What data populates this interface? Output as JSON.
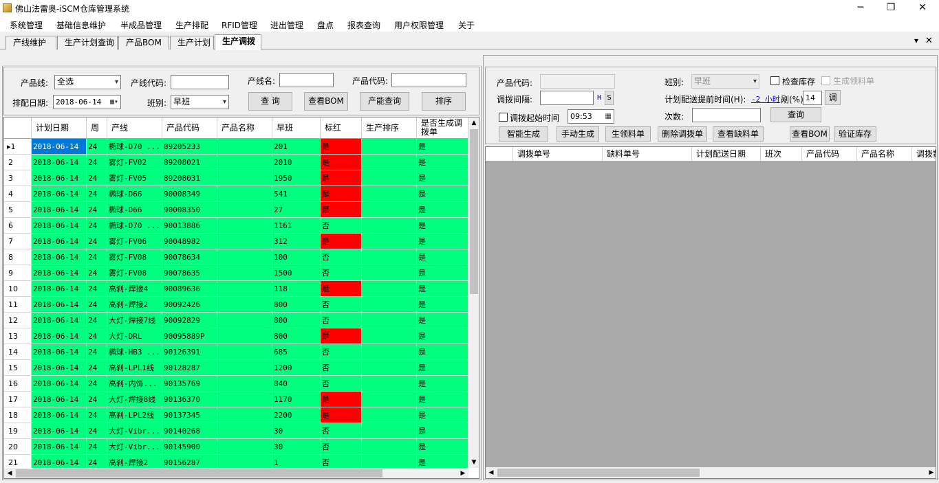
{
  "window": {
    "title": "佛山法雷奥-iSCM仓库管理系统",
    "minimize": "─",
    "maximize": "❐",
    "close": "✕"
  },
  "menu": [
    "系统管理",
    "基础信息维护",
    "半成品管理",
    "生产排配",
    "RFID管理",
    "进出管理",
    "盘点",
    "报表查询",
    "用户权限管理",
    "关于"
  ],
  "tabs": [
    "产线维护",
    "生产计划查询",
    "产品BOM",
    "生产计划",
    "生产调拨"
  ],
  "tab_controls": {
    "dropdown": "▾",
    "close": "✕"
  },
  "left_form": {
    "line_label": "产品线:",
    "line_value": "全选",
    "line_code_label": "产线代码:",
    "line_code_value": "",
    "line_name_label": "产线名:",
    "line_name_value": "",
    "product_code_label": "产品代码:",
    "product_code_value": "",
    "date_label": "排配日期:",
    "date_value": "2018-06-14",
    "shift_label": "班别:",
    "shift_value": "早班",
    "query_btn": "查 询",
    "bom_btn": "查看BOM",
    "capacity_btn": "产能查询",
    "sort_btn": "排序"
  },
  "left_grid": {
    "columns": [
      "计划日期",
      "周",
      "产线",
      "产品代码",
      "产品名称",
      "早班",
      "标红",
      "生产排序",
      "是否生成调拨单"
    ],
    "rows": [
      {
        "n": "1",
        "date": "2018-06-14",
        "week": "24",
        "line": "椭球-D70 ...",
        "code": "89205233",
        "name": "",
        "qty": "201",
        "red": "是",
        "sort": "",
        "gen": "是"
      },
      {
        "n": "2",
        "date": "2018-06-14",
        "week": "24",
        "line": "雾灯-FV02",
        "code": "89208021",
        "name": "",
        "qty": "2010",
        "red": "是",
        "sort": "",
        "gen": "是"
      },
      {
        "n": "3",
        "date": "2018-06-14",
        "week": "24",
        "line": "雾灯-FV05",
        "code": "89208031",
        "name": "",
        "qty": "1950",
        "red": "是",
        "sort": "",
        "gen": "是"
      },
      {
        "n": "4",
        "date": "2018-06-14",
        "week": "24",
        "line": "椭球-D66",
        "code": "90008349",
        "name": "",
        "qty": "541",
        "red": "是",
        "sort": "",
        "gen": "是"
      },
      {
        "n": "5",
        "date": "2018-06-14",
        "week": "24",
        "line": "椭球-D66",
        "code": "90008350",
        "name": "",
        "qty": "27",
        "red": "是",
        "sort": "",
        "gen": "是"
      },
      {
        "n": "6",
        "date": "2018-06-14",
        "week": "24",
        "line": "椭球-D70 ...",
        "code": "90013886",
        "name": "",
        "qty": "1161",
        "red": "否",
        "sort": "",
        "gen": "是"
      },
      {
        "n": "7",
        "date": "2018-06-14",
        "week": "24",
        "line": "雾灯-FV06",
        "code": "90048982",
        "name": "",
        "qty": "312",
        "red": "是",
        "sort": "",
        "gen": "是"
      },
      {
        "n": "8",
        "date": "2018-06-14",
        "week": "24",
        "line": "雾灯-FV08",
        "code": "90078634",
        "name": "",
        "qty": "100",
        "red": "否",
        "sort": "",
        "gen": "是"
      },
      {
        "n": "9",
        "date": "2018-06-14",
        "week": "24",
        "line": "雾灯-FV08",
        "code": "90078635",
        "name": "",
        "qty": "1500",
        "red": "否",
        "sort": "",
        "gen": "是"
      },
      {
        "n": "10",
        "date": "2018-06-14",
        "week": "24",
        "line": "高刹-焊接4",
        "code": "90089636",
        "name": "",
        "qty": "118",
        "red": "是",
        "sort": "",
        "gen": "是"
      },
      {
        "n": "11",
        "date": "2018-06-14",
        "week": "24",
        "line": "高刹-焊接2",
        "code": "90092426",
        "name": "",
        "qty": "800",
        "red": "否",
        "sort": "",
        "gen": "是"
      },
      {
        "n": "12",
        "date": "2018-06-14",
        "week": "24",
        "line": "大灯-焊接7线",
        "code": "90092829",
        "name": "",
        "qty": "800",
        "red": "否",
        "sort": "",
        "gen": "是"
      },
      {
        "n": "13",
        "date": "2018-06-14",
        "week": "24",
        "line": "大灯-DRL",
        "code": "90095889P",
        "name": "",
        "qty": "800",
        "red": "是",
        "sort": "",
        "gen": "是"
      },
      {
        "n": "14",
        "date": "2018-06-14",
        "week": "24",
        "line": "椭球-HB3 ...",
        "code": "90126391",
        "name": "",
        "qty": "685",
        "red": "否",
        "sort": "",
        "gen": "是"
      },
      {
        "n": "15",
        "date": "2018-06-14",
        "week": "24",
        "line": "高刹-LPL1线",
        "code": "90128287",
        "name": "",
        "qty": "1200",
        "red": "否",
        "sort": "",
        "gen": "是"
      },
      {
        "n": "16",
        "date": "2018-06-14",
        "week": "24",
        "line": "高刹-内饰...",
        "code": "90135769",
        "name": "",
        "qty": "840",
        "red": "否",
        "sort": "",
        "gen": "是"
      },
      {
        "n": "17",
        "date": "2018-06-14",
        "week": "24",
        "line": "大灯-焊接8线",
        "code": "90136370",
        "name": "",
        "qty": "1170",
        "red": "是",
        "sort": "",
        "gen": "是"
      },
      {
        "n": "18",
        "date": "2018-06-14",
        "week": "24",
        "line": "高刹-LPL2线",
        "code": "90137345",
        "name": "",
        "qty": "2200",
        "red": "是",
        "sort": "",
        "gen": "是"
      },
      {
        "n": "19",
        "date": "2018-06-14",
        "week": "24",
        "line": "大灯-Vibr...",
        "code": "90140268",
        "name": "",
        "qty": "30",
        "red": "否",
        "sort": "",
        "gen": "是"
      },
      {
        "n": "20",
        "date": "2018-06-14",
        "week": "24",
        "line": "大灯-Vibr...",
        "code": "90145900",
        "name": "",
        "qty": "30",
        "red": "否",
        "sort": "",
        "gen": "是"
      },
      {
        "n": "21",
        "date": "2018-06-14",
        "week": "24",
        "line": "高刹-焊接2",
        "code": "90156287",
        "name": "",
        "qty": "1",
        "red": "否",
        "sort": "",
        "gen": "是"
      }
    ]
  },
  "right_form": {
    "product_code_label": "产品代码:",
    "product_code_value": "",
    "shift_label": "班别:",
    "shift_value": "早班",
    "check_stock_label": "检查库存",
    "gen_pick_label": "生成领料单",
    "interval_label": "调拨间隔:",
    "interval_value": "",
    "unit_h": "H",
    "unit_s": "S",
    "lead_time_label": "计划配送提前时间(H):",
    "lead_time_link": "-2 小时",
    "lead_suffix": "剐(%):",
    "lead_pct": "14",
    "adjust_btn": "调",
    "start_time_label": "调拨起始时间",
    "start_time_value": "09:53",
    "times_label": "次数:",
    "times_value": "",
    "query_btn": "查询",
    "buttons": [
      "智能生成",
      "手动生成",
      "生领料单",
      "删除调拨单",
      "查看缺料单"
    ],
    "bom_btn": "查看BOM",
    "verify_btn": "验证库存"
  },
  "right_grid": {
    "columns": [
      "调拨单号",
      "缺料单号",
      "计划配送日期",
      "班次",
      "产品代码",
      "产品名称",
      "调拨数"
    ]
  },
  "colors": {
    "row_bg": "#00ff7f",
    "flag_red": "#ff0000",
    "selection": "#0078d7",
    "empty_grid": "#ababab"
  }
}
